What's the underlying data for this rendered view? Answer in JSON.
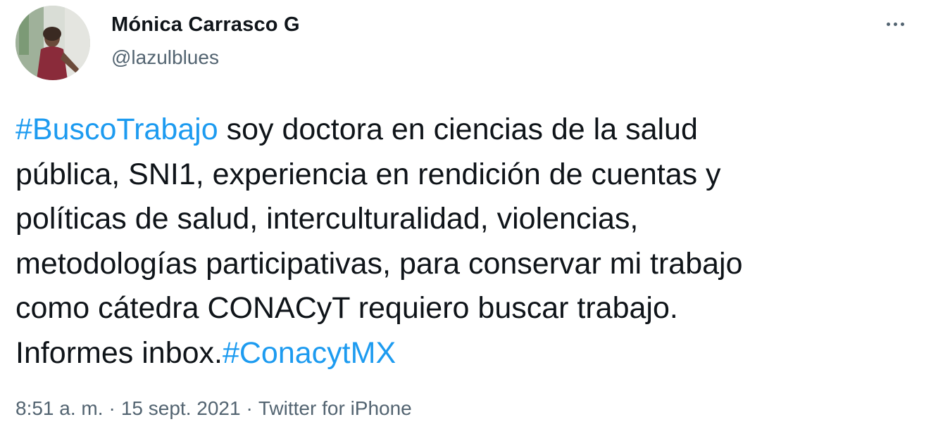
{
  "author": {
    "display_name": "Mónica Carrasco G",
    "handle": "@lazulblues"
  },
  "more_icon": "more-horizontal-icon",
  "tweet": {
    "line1": {
      "hashtag": "#BuscoTrabajo",
      "text": " soy doctora en ciencias de la salud"
    },
    "line2": "pública, SNI1, experiencia en rendición de cuentas y",
    "line3": "políticas de salud, interculturalidad, violencias,",
    "line4": "metodologías participativas, para conservar mi trabajo",
    "line5": "como cátedra CONACyT requiero buscar trabajo.",
    "line6": {
      "text": "Informes inbox.",
      "hashtag": "#ConacytMX"
    }
  },
  "meta": {
    "time": "8:51 a. m.",
    "separator": "·",
    "date": "15 sept. 2021",
    "source": "Twitter for iPhone"
  },
  "colors": {
    "hashtag": "#1d9bf0",
    "secondary_text": "#536471",
    "primary_text": "#0f1419"
  }
}
